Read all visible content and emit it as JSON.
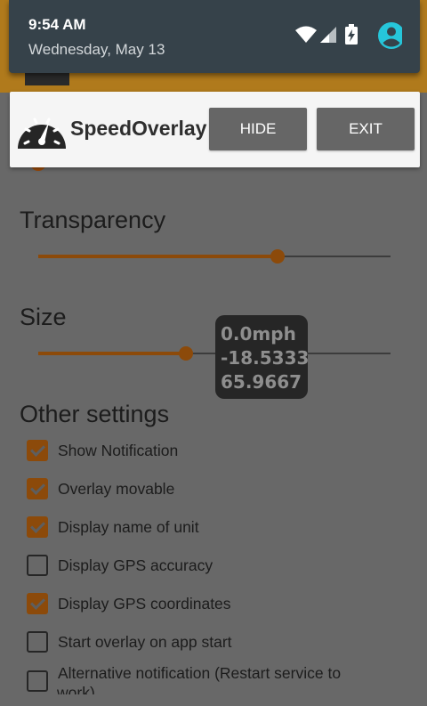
{
  "status_shade": {
    "time": "9:54 AM",
    "date": "Wednesday, May 13",
    "icons": [
      "wifi-icon",
      "cell-signal-icon",
      "battery-charging-icon",
      "account-icon"
    ]
  },
  "overlay_card": {
    "app_name": "SpeedOverlay",
    "logo_icon": "speedometer-icon",
    "hide_label": "HIDE",
    "exit_label": "EXIT"
  },
  "settings": {
    "transparency": {
      "title": "Transparency",
      "value_fraction": 0.68
    },
    "size": {
      "title": "Size",
      "value_fraction": 0.42
    },
    "other_title": "Other settings",
    "checkboxes": [
      {
        "label": "Show Notification",
        "checked": true
      },
      {
        "label": "Overlay movable",
        "checked": true
      },
      {
        "label": "Display name of unit",
        "checked": true
      },
      {
        "label": "Display GPS accuracy",
        "checked": false
      },
      {
        "label": "Display GPS coordinates",
        "checked": true
      },
      {
        "label": "Start overlay on app start",
        "checked": false
      },
      {
        "label": "Alternative notification (Restart service to",
        "checked": false
      }
    ],
    "cut_off_text": "work)"
  },
  "speed_overlay": {
    "speed": "0.0mph",
    "latitude": "-18.5333",
    "longitude": "65.9667"
  },
  "colors": {
    "accent": "#8c4a0a",
    "shade_bg": "#36424a",
    "account_icon": "#26c6da",
    "button_bg": "#666666"
  }
}
